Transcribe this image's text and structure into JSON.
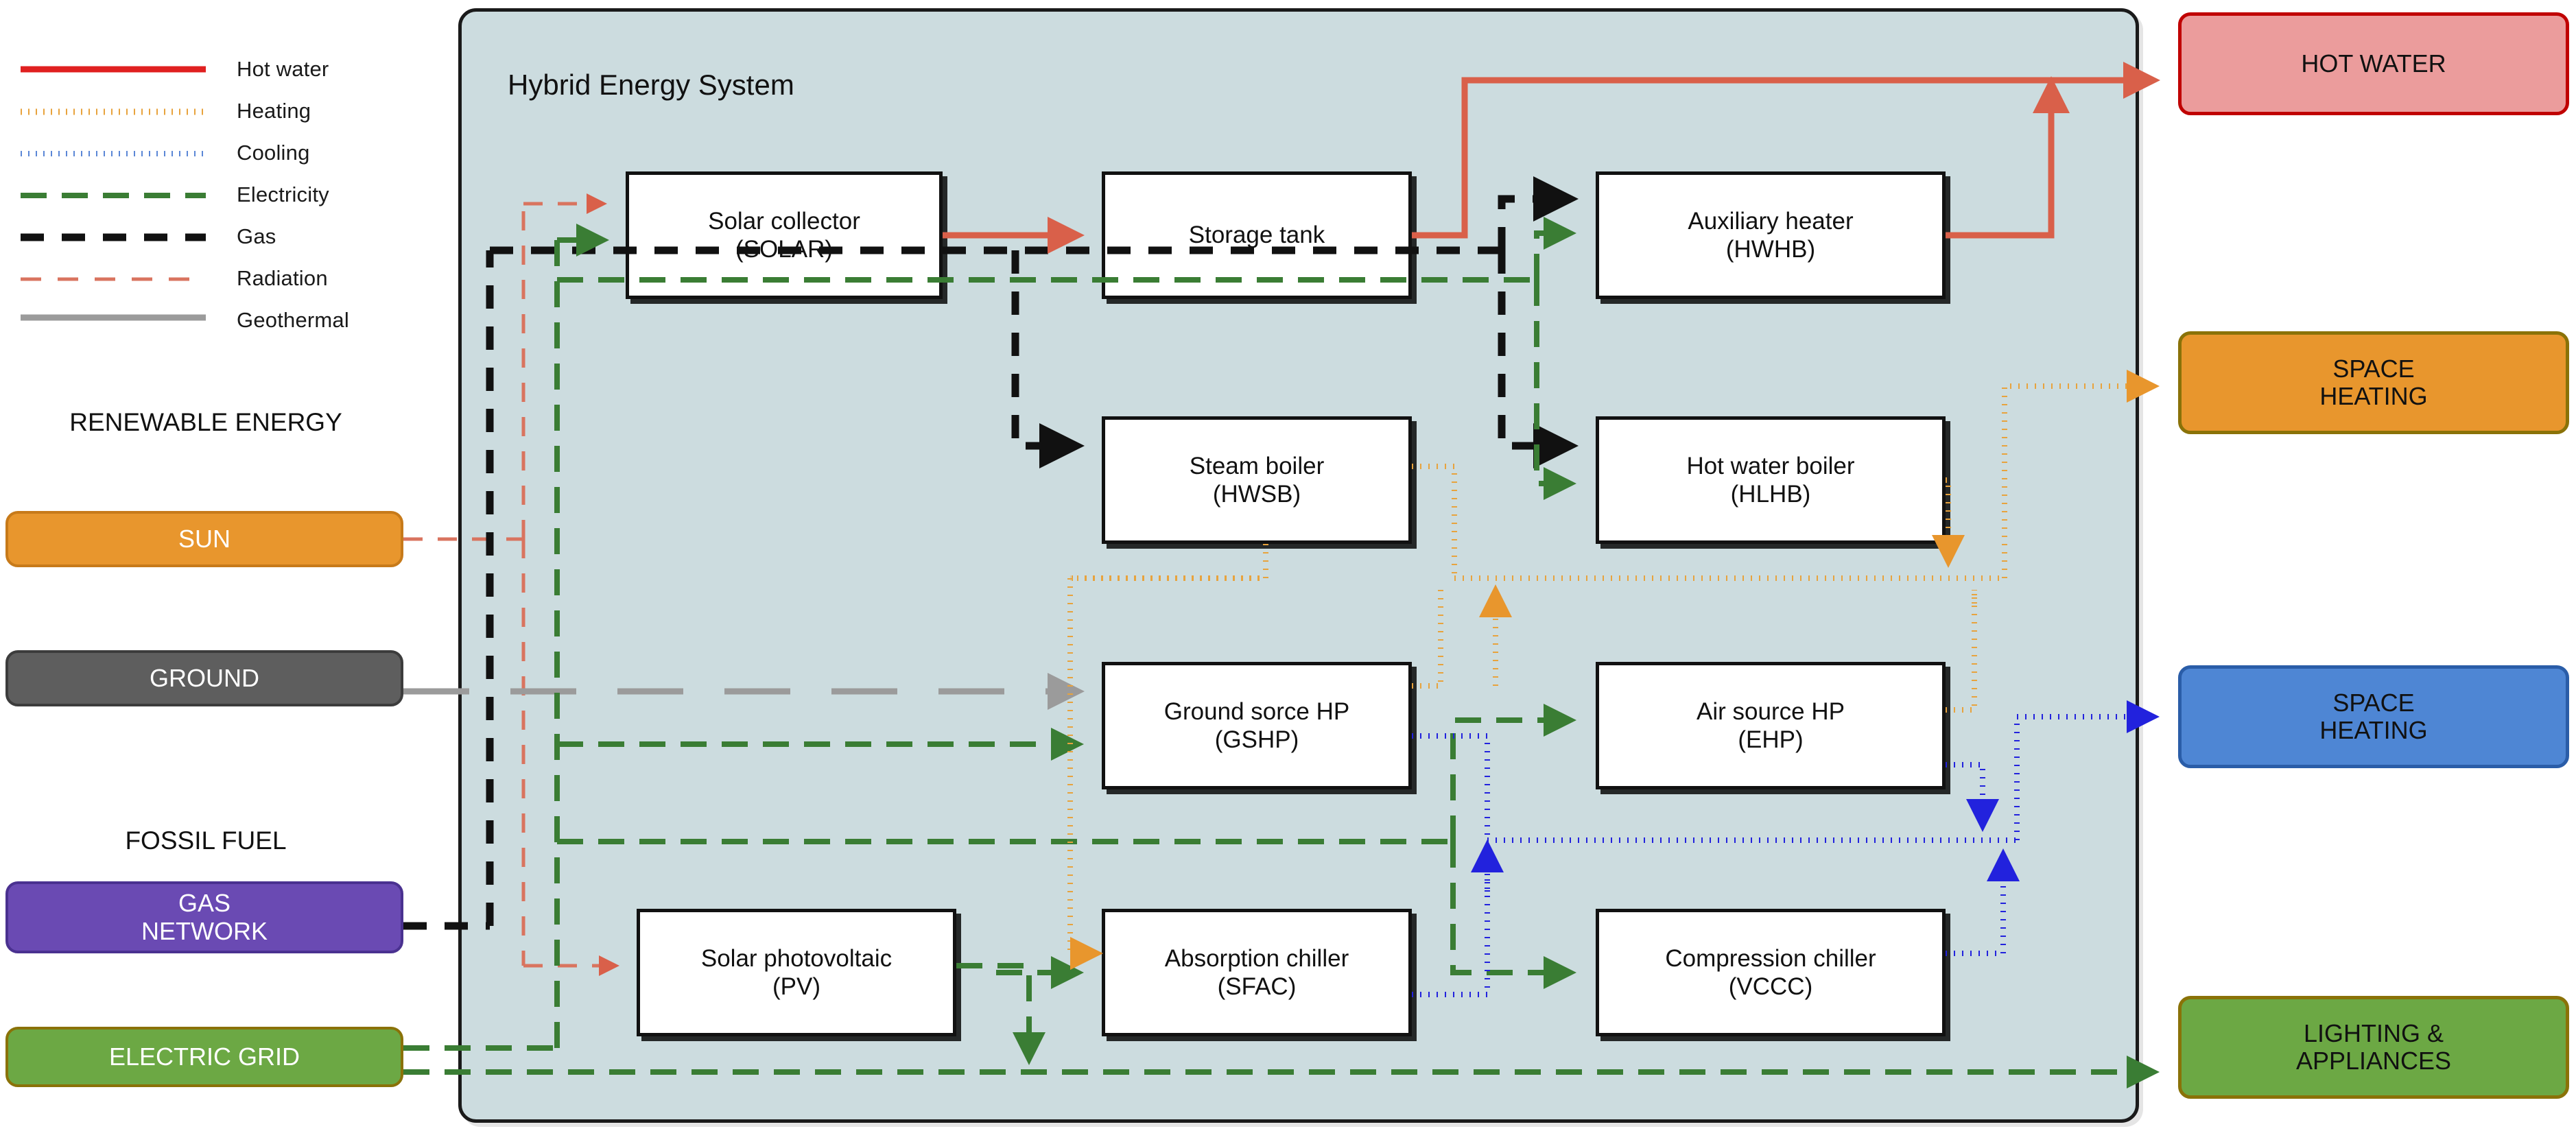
{
  "legend": {
    "items": [
      {
        "label": "Hot water",
        "color": "#e02020",
        "style": "solid",
        "width": 7
      },
      {
        "label": "Heating",
        "color": "#e8a33d",
        "style": "dotted",
        "width": 7
      },
      {
        "label": "Cooling",
        "color": "#5b87d6",
        "style": "dotted",
        "width": 7
      },
      {
        "label": "Electricity",
        "color": "#3a7d34",
        "style": "dashed",
        "width": 7
      },
      {
        "label": "Gas",
        "color": "#111111",
        "style": "dashed",
        "width": 9
      },
      {
        "label": "Radiation",
        "color": "#d9745f",
        "style": "dashed",
        "width": 5
      },
      {
        "label": "Geothermal",
        "color": "#9b9b9b",
        "style": "solid",
        "width": 8
      }
    ]
  },
  "groups": [
    {
      "name": "renewable",
      "label": "RENEWABLE\nENERGY"
    },
    {
      "name": "fossil_fuel",
      "label": "FOSSIL FUEL"
    }
  ],
  "sources": [
    {
      "name": "sun",
      "label": "SUN",
      "fill": "#e8962d",
      "stroke": "#c77a1a",
      "text": "#ffffff"
    },
    {
      "name": "ground",
      "label": "GROUND",
      "fill": "#5e5e5e",
      "stroke": "#3c3c3c",
      "text": "#ffffff"
    },
    {
      "name": "gas-network",
      "label": "GAS\nNETWORK",
      "fill": "#6a4ab3",
      "stroke": "#4a3190",
      "text": "#ffffff"
    },
    {
      "name": "electric-grid",
      "label": "ELECTRIC GRID",
      "fill": "#6ca844",
      "stroke": "#8a7208",
      "text": "#ffffff"
    }
  ],
  "system": {
    "title": "Hybrid Energy System",
    "fill": "#ccdcdf",
    "stroke": "#1a1a1a",
    "boxes": [
      {
        "name": "solar-collector",
        "line1": "Solar collector",
        "line2": "(SOLAR)"
      },
      {
        "name": "storage-tank",
        "line1": "Storage tank",
        "line2": ""
      },
      {
        "name": "auxiliary-heater",
        "line1": "Auxiliary heater",
        "line2": "(HWHB)"
      },
      {
        "name": "steam-boiler",
        "line1": "Steam boiler",
        "line2": "(HWSB)"
      },
      {
        "name": "hot-water-boiler",
        "line1": "Hot water boiler",
        "line2": "(HLHB)"
      },
      {
        "name": "ground-source-hp",
        "line1": "Ground sorce HP",
        "line2": "(GSHP)"
      },
      {
        "name": "air-source-hp",
        "line1": "Air source HP",
        "line2": "(EHP)"
      },
      {
        "name": "solar-photovoltaic",
        "line1": "Solar photovoltaic",
        "line2": "(PV)"
      },
      {
        "name": "absorption-chiller",
        "line1": "Absorption chiller",
        "line2": "(SFAC)"
      },
      {
        "name": "compression-chiller",
        "line1": "Compression chiller",
        "line2": "(VCCC)"
      }
    ]
  },
  "demands": [
    {
      "name": "hot-water",
      "label": "HOT WATER",
      "fill": "#eb9c9c",
      "stroke": "#c00000",
      "text": "#111111"
    },
    {
      "name": "space-heating-orange",
      "label": "SPACE\nHEATING",
      "fill": "#e8962d",
      "stroke": "#8a7208",
      "text": "#111111"
    },
    {
      "name": "space-heating-blue",
      "label": "SPACE\nHEATING",
      "fill": "#4e86d4",
      "stroke": "#2a5da8",
      "text": "#111111"
    },
    {
      "name": "lighting-appliances",
      "label": "LIGHTING &\nAPPLIANCES",
      "fill": "#6ca844",
      "stroke": "#8a7208",
      "text": "#111111"
    }
  ],
  "flow_colors": {
    "hot_water": "#d9604a",
    "heating": "#e8a33d",
    "cooling": "#2222dd",
    "electricity": "#3a7d34",
    "gas": "#111111",
    "radiation": "#d9745f",
    "geothermal": "#9b9b9b"
  }
}
